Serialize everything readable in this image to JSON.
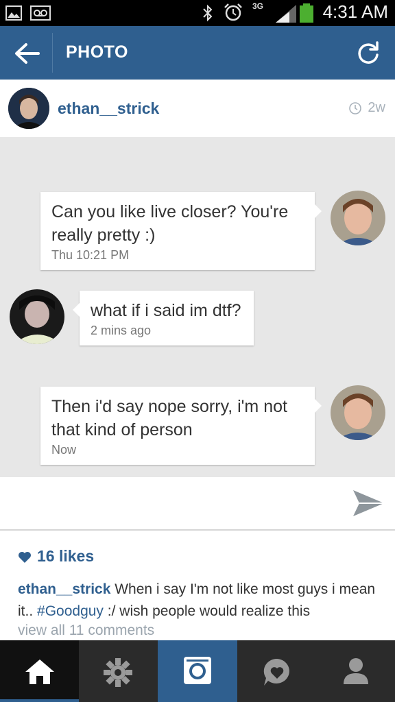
{
  "status_bar": {
    "time": "4:31 AM",
    "network": "3G"
  },
  "header": {
    "title": "PHOTO"
  },
  "post": {
    "username": "ethan__strick",
    "age": "2w"
  },
  "chat": [
    {
      "side": "right",
      "lines": [
        "Can you like live closer?  You're",
        "really pretty :)"
      ],
      "time": "Thu  10:21 PM"
    },
    {
      "side": "left",
      "lines": [
        "what if i said im dtf?"
      ],
      "time": "2 mins ago"
    },
    {
      "side": "right",
      "lines": [
        "Then i'd say nope sorry,  i'm not",
        "that kind of person"
      ],
      "time": "Now"
    }
  ],
  "likes": "16 likes",
  "caption": {
    "username": "ethan__strick",
    "text_before": " When i say I'm not like most guys  i mean it.. ",
    "hashtag": "#Goodguy",
    "text_after": " :/ wish people would realize this"
  },
  "view_all": "view all 11 comments",
  "colors": {
    "brand": "#2f5f8f",
    "nav": "#2b2b2b",
    "chat_bg": "#e7e7e7"
  },
  "icons": {
    "status": [
      "voicemail-icon",
      "image-icon",
      "bluetooth-icon",
      "alarm-icon",
      "signal-icon",
      "battery-icon"
    ],
    "nav": [
      "home-icon",
      "explore-icon",
      "camera-icon",
      "activity-icon",
      "profile-icon"
    ]
  }
}
